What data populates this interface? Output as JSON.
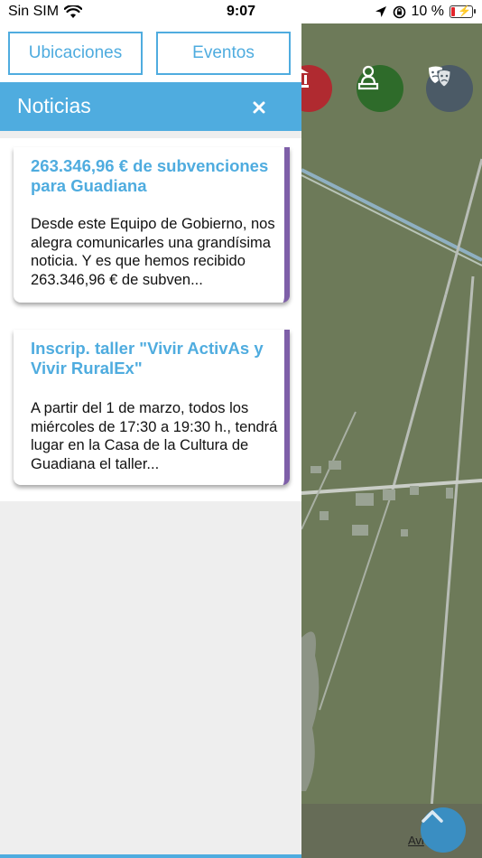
{
  "status_bar": {
    "carrier": "Sin SIM",
    "time": "9:07",
    "battery": "10 %"
  },
  "tabs": {
    "ubicaciones": "Ubicaciones",
    "eventos": "Eventos"
  },
  "news_panel": {
    "title": "Noticias",
    "items": [
      {
        "title": "263.346,96 € de subvenciones para Guadiana",
        "excerpt": "Desde este Equipo de Gobierno, nos alegra comunicarles una grandísima noticia. Y es que hemos recibido 263.346,96 € de subven..."
      },
      {
        "title": "Inscrip. taller \"Vivir ActivAs y Vivir RuralEx\"",
        "excerpt": "A partir del 1 de marzo, todos los miércoles de 17:30 a 19:30 h., tendrá lugar en la Casa de la Cultura de Guadiana el taller..."
      }
    ]
  },
  "map": {
    "attribution": "Avi",
    "category_icons": [
      {
        "name": "museum-icon",
        "color": "#b02a30"
      },
      {
        "name": "monument-icon",
        "color": "#2e6b2a"
      },
      {
        "name": "theater-icon",
        "color": "#4b5a66"
      }
    ]
  },
  "colors": {
    "accent": "#4facdf",
    "card_border": "#7e5fa8",
    "map": "#6d7a59"
  }
}
